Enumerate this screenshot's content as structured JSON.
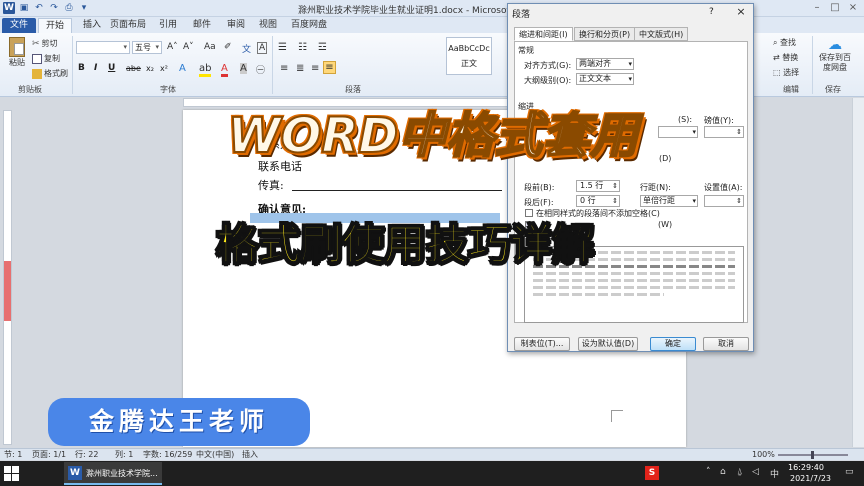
{
  "window": {
    "title": "滁州职业技术学院毕业生就业证明1.docx - Microsoft Word",
    "minimize_icon": "minimize-icon",
    "maximize_icon": "maximize-icon",
    "close_icon": "close-icon"
  },
  "ribbon": {
    "tabs": [
      "文件",
      "开始",
      "插入",
      "页面布局",
      "引用",
      "邮件",
      "审阅",
      "视图",
      "百度网盘"
    ],
    "clipboard": {
      "paste": "粘贴",
      "cut": "剪切",
      "copy": "复制",
      "format_painter": "格式刷",
      "label": "剪贴板"
    },
    "font": {
      "font_name": "",
      "font_size": "五号",
      "label": "字体",
      "bold": "B",
      "italic": "I",
      "underline": "U",
      "strike": "abe",
      "sub": "x₂",
      "sup": "x²"
    },
    "paragraph": {
      "label": "段落"
    },
    "styles": {
      "sample": "AaBbCcDc",
      "name": "正文"
    },
    "editing": {
      "find": "查找",
      "replace": "替换",
      "select": "选择",
      "label": "编辑"
    },
    "save": {
      "button": "保存到百度网盘",
      "label": "保存"
    }
  },
  "document": {
    "lines": [
      "联系人",
      "联系电话",
      "传真:",
      "确认意见:"
    ],
    "highlight_color": "#9fc4ea"
  },
  "dialog": {
    "title": "段落",
    "help": "?",
    "close": "×",
    "tabs": [
      "缩进和间距(I)",
      "换行和分页(P)",
      "中文版式(H)"
    ],
    "general": {
      "heading": "常规",
      "alignment_label": "对齐方式(G):",
      "alignment_value": "两端对齐",
      "outline_label": "大纲级别(O):",
      "outline_value": "正文文本"
    },
    "indent": {
      "heading": "缩进",
      "value_label": "磅值(Y):",
      "left_paren": "(S):"
    },
    "spacing": {
      "grid_suffix": "(D)",
      "before_label": "段前(B):",
      "before_value": "1.5 行",
      "after_label": "段后(F):",
      "after_value": "0 行",
      "line_spacing_label": "行距(N):",
      "line_spacing_value": "单倍行距",
      "set_value_label": "设置值(A):",
      "no_space_same_style": "在相同样式的段落间不添加空格(C)",
      "grid_align_suffix": "(W)"
    },
    "buttons": {
      "tabs": "制表位(T)...",
      "default": "设为默认值(D)",
      "ok": "确定",
      "cancel": "取消"
    }
  },
  "overlay": {
    "title": "WORD中格式套用",
    "subtitle": "格式刷使用技巧详解",
    "author": "金腾达王老师"
  },
  "statusbar": {
    "section": "节: 1",
    "page": "页面: 1/1",
    "line": "行: 22",
    "column": "列: 1",
    "words": "字数: 16/259",
    "language": "中文(中国)",
    "mode": "插入",
    "zoom": "100%"
  },
  "taskbar": {
    "app_label": "滁州职业技术学院...",
    "tray_s": "S",
    "tray_lang": "中",
    "clock_time": "16:29:40",
    "clock_date": "2021/7/23"
  }
}
